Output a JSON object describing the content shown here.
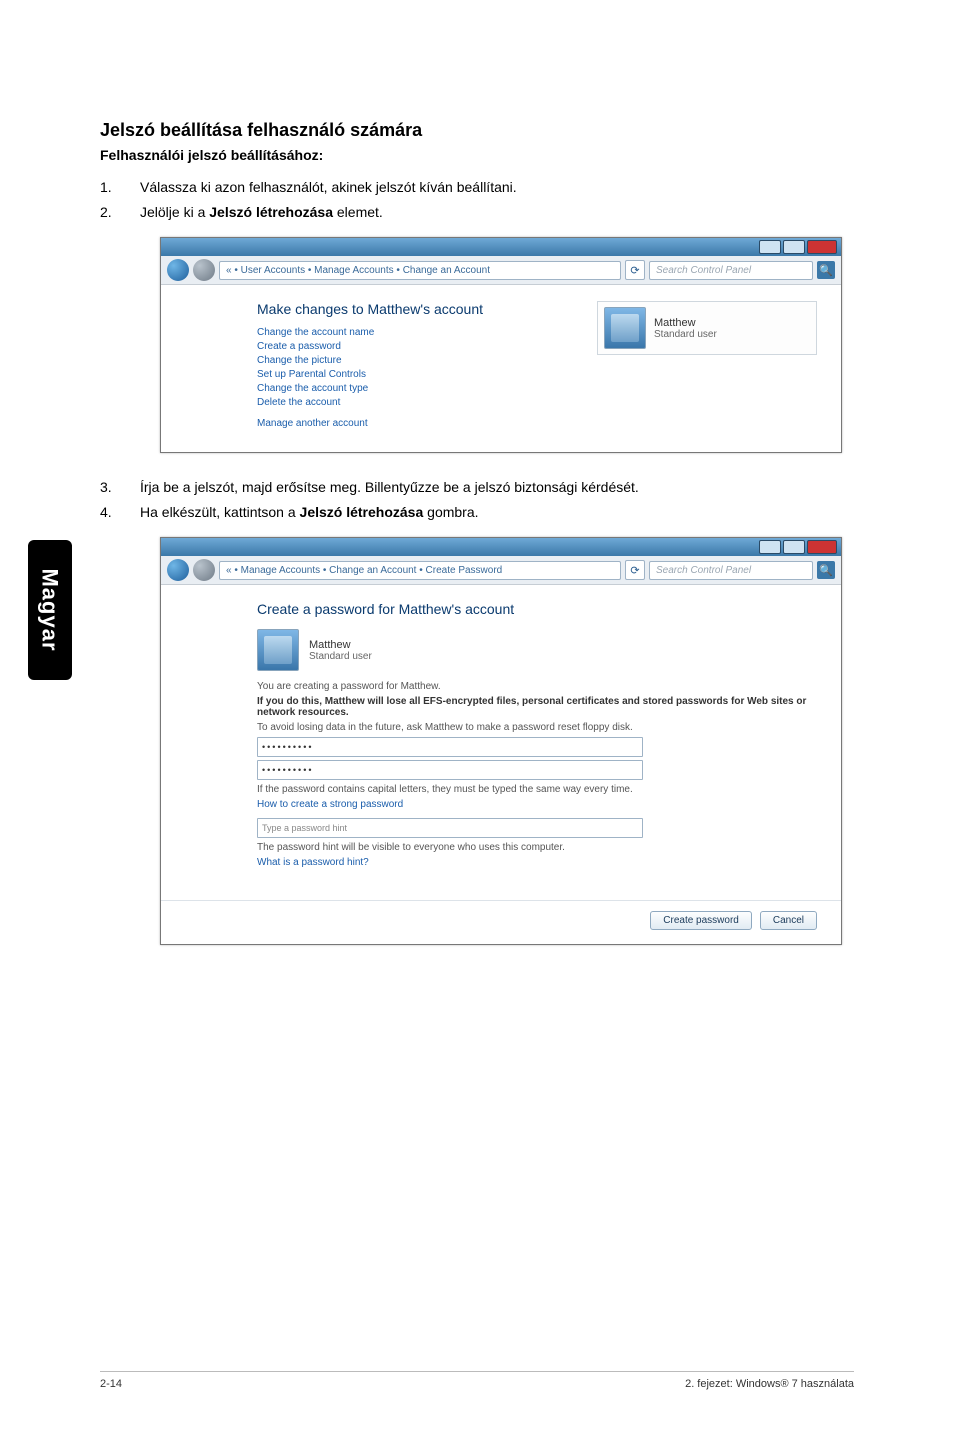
{
  "sidebar": {
    "label": "Magyar"
  },
  "heading": "Jelszó beállítása felhasználó számára",
  "subheading": "Felhasználói jelszó beállításához:",
  "steps_a": [
    {
      "n": "1.",
      "t": "Válassza ki azon felhasználót, akinek jelszót kíván beállítani."
    },
    {
      "n": "2.",
      "t_before": "Jelölje ki a ",
      "t_bold": "Jelszó létrehozása",
      "t_after": " elemet."
    }
  ],
  "shot1": {
    "breadcrumb": "« • User Accounts • Manage Accounts • Change an Account",
    "search_placeholder": "Search Control Panel",
    "heading": "Make changes to Matthew's account",
    "links": [
      "Change the account name",
      "Create a password",
      "Change the picture",
      "Set up Parental Controls",
      "Change the account type",
      "Delete the account",
      "Manage another account"
    ],
    "user_name": "Matthew",
    "user_type": "Standard user"
  },
  "steps_b": [
    {
      "n": "3.",
      "t": "Írja be a jelszót, majd erősítse meg. Billentyűzze be a jelszó biztonsági kérdését."
    },
    {
      "n": "4.",
      "t_before": "Ha elkészült, kattintson a ",
      "t_bold": "Jelszó létrehozása",
      "t_after": " gombra."
    }
  ],
  "shot2": {
    "breadcrumb": "« • Manage Accounts • Change an Account • Create Password",
    "search_placeholder": "Search Control Panel",
    "heading": "Create a password for Matthew's account",
    "user_name": "Matthew",
    "user_type": "Standard user",
    "line1": "You are creating a password for Matthew.",
    "line2": "If you do this, Matthew will lose all EFS-encrypted files, personal certificates and stored passwords for Web sites or network resources.",
    "line3": "To avoid losing data in the future, ask Matthew to make a password reset floppy disk.",
    "pw_mask": "••••••••••",
    "line4": "If the password contains capital letters, they must be typed the same way every time.",
    "link1": "How to create a strong password",
    "hint_placeholder": "Type a password hint",
    "line5": "The password hint will be visible to everyone who uses this computer.",
    "link2": "What is a password hint?",
    "btn_create": "Create password",
    "btn_cancel": "Cancel"
  },
  "footer": {
    "left": "2-14",
    "right": "2. fejezet: Windows® 7 használata"
  }
}
